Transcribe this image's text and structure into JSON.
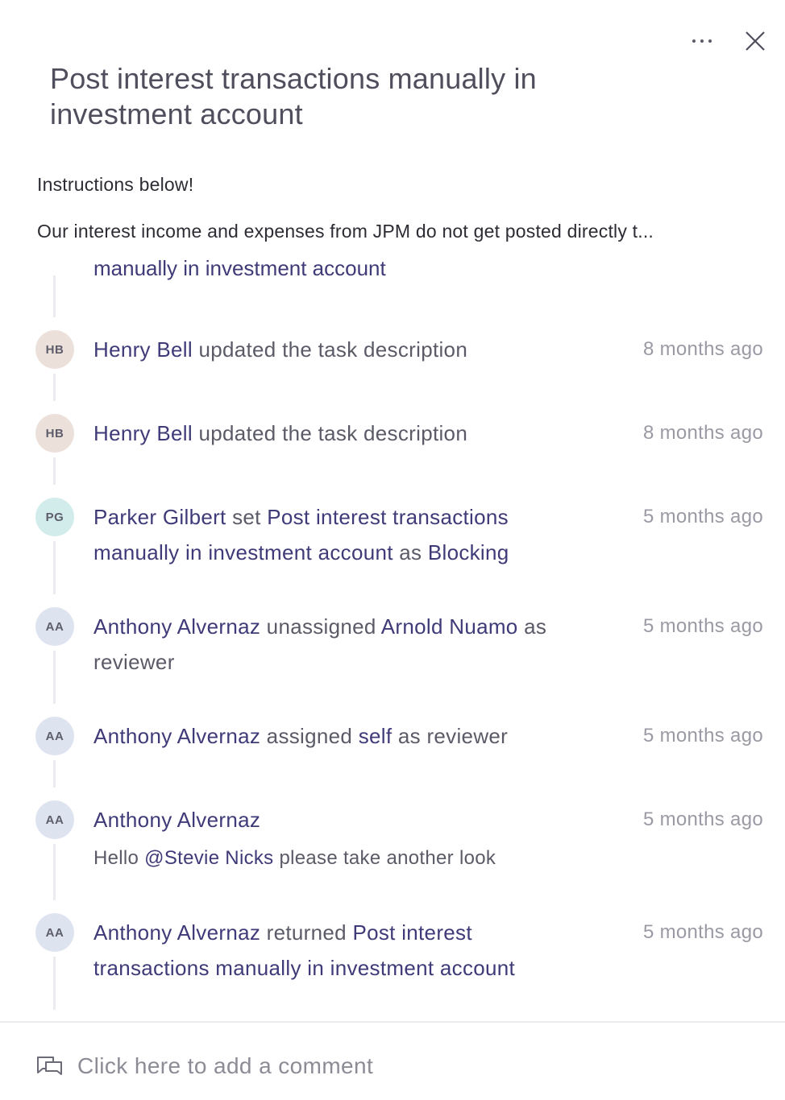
{
  "header": {
    "more_icon": "ellipsis-icon",
    "close_icon": "close-icon"
  },
  "task": {
    "title": "Post interest transactions manually in investment account"
  },
  "description": {
    "line1": "Instructions below!",
    "line2": "Our interest income and expenses from JPM do not get posted directly t..."
  },
  "activity": {
    "clipped_text": "manually in investment account",
    "items": [
      {
        "avatar": "HB",
        "actor": "Henry Bell",
        "text": " updated the task description",
        "time": "8 months ago"
      },
      {
        "avatar": "HB",
        "actor": "Henry Bell",
        "text": " updated the task description",
        "time": "8 months ago"
      },
      {
        "avatar": "PG",
        "actor": "Parker Gilbert",
        "t1": " set ",
        "link1": "Post interest transactions manually in investment account",
        "t2": " as ",
        "link2": "Blocking",
        "time": "5 months ago"
      },
      {
        "avatar": "AA",
        "actor": "Anthony Alvernaz",
        "t1": " unassigned ",
        "link1": "Arnold Nuamo",
        "t2": " as reviewer",
        "time": "5 months ago"
      },
      {
        "avatar": "AA",
        "actor": "Anthony Alvernaz",
        "t1": " assigned ",
        "link1": "self",
        "t2": " as reviewer",
        "time": "5 months ago"
      },
      {
        "avatar": "AA",
        "actor": "Anthony Alvernaz",
        "comment_pre": "Hello ",
        "mention": "@Stevie Nicks",
        "comment_post": " please take another look",
        "time": "5 months ago"
      },
      {
        "avatar": "AA",
        "actor": "Anthony Alvernaz",
        "t1": " returned ",
        "link1": "Post interest transactions manually in investment account",
        "time": "5 months ago"
      }
    ]
  },
  "footer": {
    "comment_icon": "comment-icon",
    "comment_placeholder": "Click here to add a comment"
  },
  "colors": {
    "link": "#3f3a78",
    "text": "#5b5b68",
    "muted": "#9a9aa4",
    "avatar_hb": "#ece0da",
    "avatar_pg": "#d2eceb",
    "avatar_aa": "#dde4ef"
  }
}
